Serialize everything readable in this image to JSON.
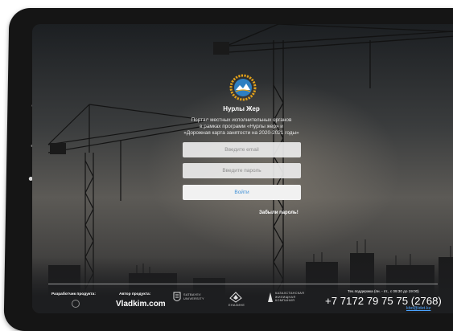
{
  "header": {
    "brand": "Нурлы Жер",
    "description": [
      "Портал местных исполнительных органов",
      "в рамках программ «Нурлы жер» и",
      "«Дорожная карта занятости на 2020-2021 годы»"
    ]
  },
  "form": {
    "email_placeholder": "Введите email",
    "password_placeholder": "Введите пароль",
    "login_label": "Войти",
    "forgot_label": "Забыли пароль!"
  },
  "footer": {
    "developer_label": "Разработчик продукта:",
    "author_label": "Автор продукта:",
    "author_name": "Vladkim.com",
    "partners": {
      "satbayev": [
        "SATBAYEV",
        "UNIVERSITY"
      ],
      "eco": "ЕНАЗИНЕ",
      "housing": [
        "КАЗАХСТАНСКАЯ",
        "ЖИЛИЩНАЯ",
        "КОМПАНИЯ"
      ]
    },
    "support_hours": "Тех.поддержка (пн. - пт., с 09:30 до 19:00)",
    "phone": "+7 7172 79 75 75 (2768)",
    "email": "kbo@idet.kz"
  },
  "colors": {
    "accent": "#3d8fd6",
    "link": "#4aa3ff",
    "logo_outer": "#e2a11a",
    "logo_inner": "#2e7fc1"
  },
  "icons": {
    "logo": "nurly-zher-emblem",
    "developer": "developer-logo-icon",
    "partners": [
      "satbayev-logo",
      "eco-logo",
      "housing-company-logo"
    ]
  }
}
